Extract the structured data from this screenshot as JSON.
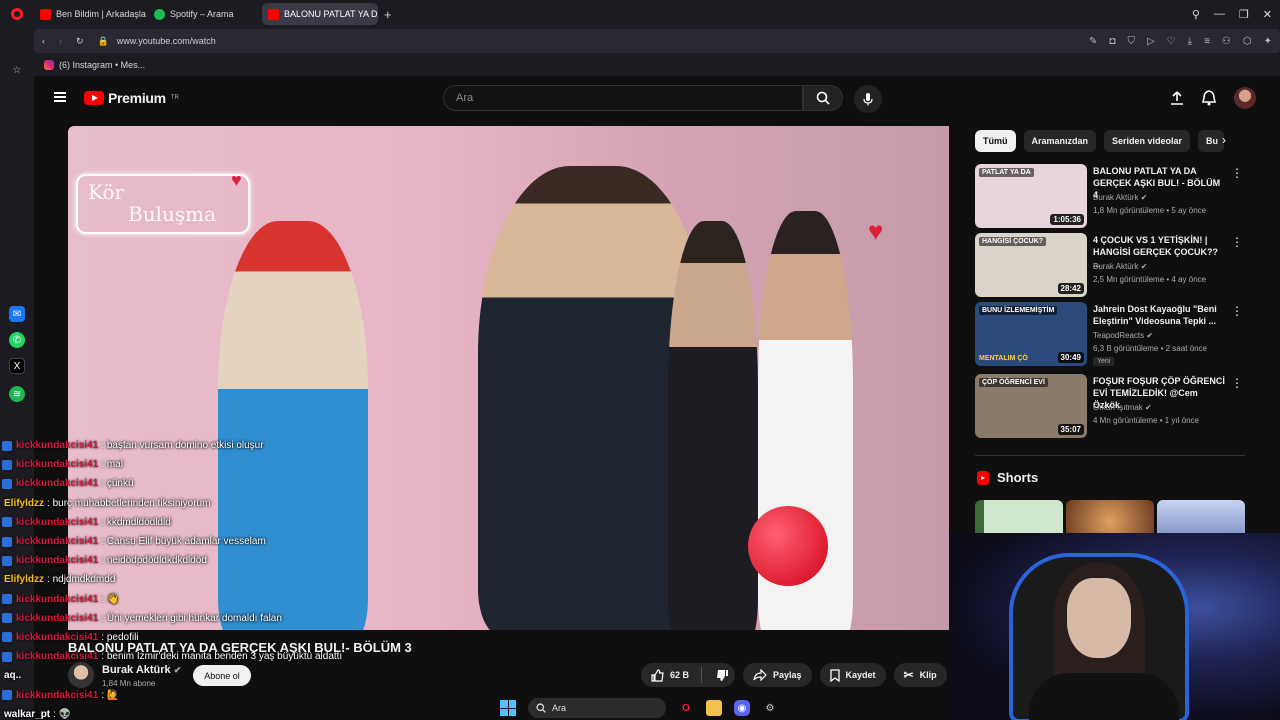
{
  "browser": {
    "tabs": [
      {
        "label": "Ben Bildim | Arkadaşlarını..",
        "color": "#ff0000"
      },
      {
        "label": "Spotify – Arama",
        "color": "#1db954"
      },
      {
        "label": "BALONU PATLAT YA DA G",
        "color": "#ff0000"
      }
    ],
    "url": "www.youtube.com/watch",
    "bookmark": "(6) Instagram • Mes..."
  },
  "yt": {
    "logo_text": "Premium",
    "logo_sup": "TR",
    "search_placeholder": "Ara"
  },
  "video": {
    "neon_line1": "Kör",
    "neon_line2": "Buluşma",
    "title": "BALONU PATLAT YA DA GERÇEK AŞKI BUL!- BÖLÜM 3",
    "channel": "Burak Aktürk",
    "subs": "1,84 Mn abone",
    "subscribe_label": "Abone ol",
    "likes": "62 B",
    "share_label": "Paylaş",
    "save_label": "Kaydet",
    "clip_label": "Klip"
  },
  "chat": [
    {
      "user": "kickkundakcisi41",
      "style": "red",
      "msg": ": baştan vursam domino etkisi oluşur"
    },
    {
      "user": "kickkundakcisi41",
      "style": "red",
      "msg": ": mal"
    },
    {
      "user": "kickkundakcisi41",
      "style": "red",
      "msg": ": çünkü"
    },
    {
      "user": "Elifyldzz",
      "style": "yel",
      "msg": ": burç muhabbetlerinden tiksiniyorum"
    },
    {
      "user": "kickkundakcisi41",
      "style": "red",
      "msg": ": kkdmdldödldld"
    },
    {
      "user": "kickkundakcisi41",
      "style": "red",
      "msg": ": Cansu Elif büyük adamlar vesselam"
    },
    {
      "user": "kickkundakcisi41",
      "style": "red",
      "msg": ": neidödpdödldkdkdldöd"
    },
    {
      "user": "Elifyldzz",
      "style": "yel",
      "msg": ": ndjdmdkdmdd"
    },
    {
      "user": "kickkundakcisi41",
      "style": "red",
      "msg": ": 👋"
    },
    {
      "user": "kickkundakcisi41",
      "style": "red",
      "msg": ": Üni yemekleri gibi hünkar domaldı falan"
    },
    {
      "user": "kickkundakcisi41",
      "style": "red",
      "msg": ": pedofili"
    },
    {
      "user": "kickkundakcisi41",
      "style": "red",
      "msg": ": benim İzmir'deki manita benden 3 yaş büyüktü aldattı"
    },
    {
      "user": "aq..",
      "style": "plain",
      "msg": ""
    },
    {
      "user": "kickkundakcisi41",
      "style": "red",
      "msg": ": 🙋"
    },
    {
      "user": "walkar_pt",
      "style": "plain",
      "msg": ": 👽"
    }
  ],
  "chips": [
    "Tümü",
    "Aramanızdan",
    "Seriden videolar",
    "Bu"
  ],
  "recommendations": [
    {
      "title": "BALONU PATLAT YA DA GERÇEK AŞKI BUL! - BÖLÜM 4",
      "channel": "Burak Aktürk",
      "meta": "1,8 Mn görüntüleme • 5 ay önce",
      "duration": "1:05:36",
      "thumb": "#e6d6da",
      "badge": ""
    },
    {
      "title": "4 ÇOCUK VS 1 YETİŞKİN! | HANGİSİ GERÇEK ÇOCUK?? ...",
      "channel": "Burak Aktürk",
      "meta": "2,5 Mn görüntüleme • 4 ay önce",
      "duration": "28:42",
      "thumb": "#d9d3c8",
      "badge": ""
    },
    {
      "title": "Jahrein Dost Kayaoğlu \"Beni Eleştirin\" Videosuna Tepki ...",
      "channel": "TeapodReacts",
      "meta": "6,3 B görüntüleme • 2 saat önce",
      "duration": "30:49",
      "thumb": "#2a4a7a",
      "badge": "Yeni"
    },
    {
      "title": "FOŞUR FOŞUR ÇÖP ÖĞRENCİ EVİ TEMİZLEDİK! @Cem Özkök",
      "channel": "Orkun Işıtmak",
      "meta": "4 Mn görüntüleme • 1 yıl önce",
      "duration": "35:07",
      "thumb": "#8a7a6a",
      "badge": ""
    }
  ],
  "thumb_texts": [
    "PATLAT YA DA",
    "HANGİSİ ÇOCUK?",
    "BUNU İZLEMEMİŞTİM",
    "ÇÖP ÖĞRENCİ EVİ"
  ],
  "thumb_texts2": [
    "",
    "",
    "MENTALIM ÇÖ",
    ""
  ],
  "shorts_label": "Shorts",
  "taskbar": {
    "search": "Ara"
  }
}
